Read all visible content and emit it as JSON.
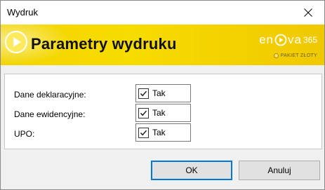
{
  "window": {
    "title": "Wydruk",
    "close_icon": "close-icon"
  },
  "banner": {
    "title": "Parametry wydruku",
    "brand": "en",
    "brand_after": "va",
    "brand_num": "365",
    "package": "PAKIET ZŁOTY",
    "play_icon": "play-icon",
    "colors": {
      "accent": "#f2d400",
      "text": "#111111"
    }
  },
  "form": {
    "rows": [
      {
        "label": "Dane deklaracyjne:",
        "value": "Tak",
        "checked": true
      },
      {
        "label": "Dane ewidencyjne:",
        "value": "Tak",
        "checked": true
      },
      {
        "label": "UPO:",
        "value": "Tak",
        "checked": true
      }
    ]
  },
  "buttons": {
    "ok": "OK",
    "cancel": "Anuluj"
  }
}
